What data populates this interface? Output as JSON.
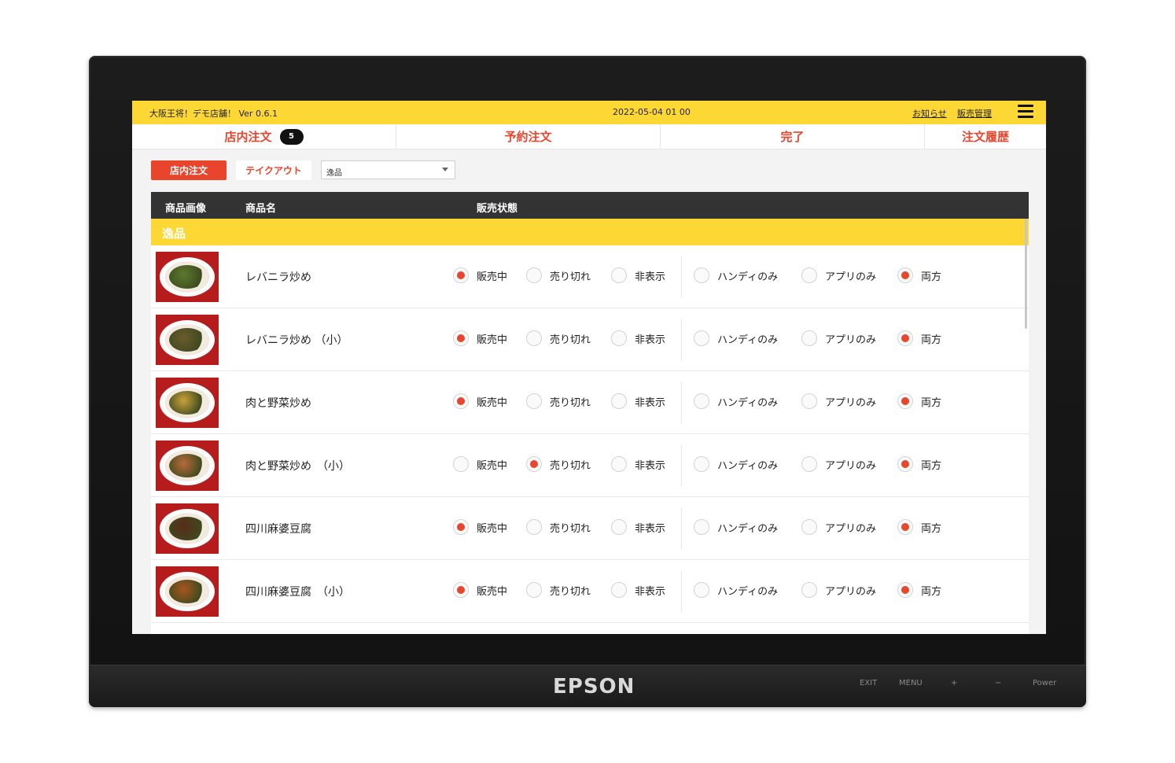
{
  "device": {
    "brand": "EPSON",
    "buttons": [
      "EXIT",
      "MENU",
      "+",
      "−",
      "Power"
    ]
  },
  "header": {
    "store": "大阪王将！デモ店舗！ Ver 0.6.1",
    "datetime": "2022-05-04 01 00",
    "links": [
      "お知らせ",
      "販売管理"
    ],
    "menu_icon": "hamburger-icon"
  },
  "tabs": [
    {
      "label": "店内注文",
      "badge": "5"
    },
    {
      "label": "予約注文"
    },
    {
      "label": "完了"
    },
    {
      "label": "注文履歴"
    }
  ],
  "filters": {
    "primary": "店内注文",
    "secondary": "テイクアウト",
    "select_value": "逸品"
  },
  "table": {
    "headers": [
      "商品画像",
      "商品名",
      "販売状態"
    ],
    "category": "逸品",
    "status_options": [
      "販売中",
      "売り切れ",
      "非表示"
    ],
    "channel_options": [
      "ハンディのみ",
      "アプリのみ",
      "両方"
    ],
    "rows": [
      {
        "name": "レバニラ炒め",
        "status": "販売中",
        "channel": "両方"
      },
      {
        "name": "レバニラ炒め （小）",
        "status": "販売中",
        "channel": "両方"
      },
      {
        "name": "肉と野菜炒め",
        "status": "販売中",
        "channel": "両方"
      },
      {
        "name": "肉と野菜炒め　（小）",
        "status": "売り切れ",
        "channel": "両方"
      },
      {
        "name": "四川麻婆豆腐",
        "status": "販売中",
        "channel": "両方"
      },
      {
        "name": "四川麻婆豆腐　（小）",
        "status": "販売中",
        "channel": "両方"
      }
    ]
  },
  "colors": {
    "accent": "#e8452c",
    "header_bg": "#fdd835",
    "table_head": "#333333"
  }
}
